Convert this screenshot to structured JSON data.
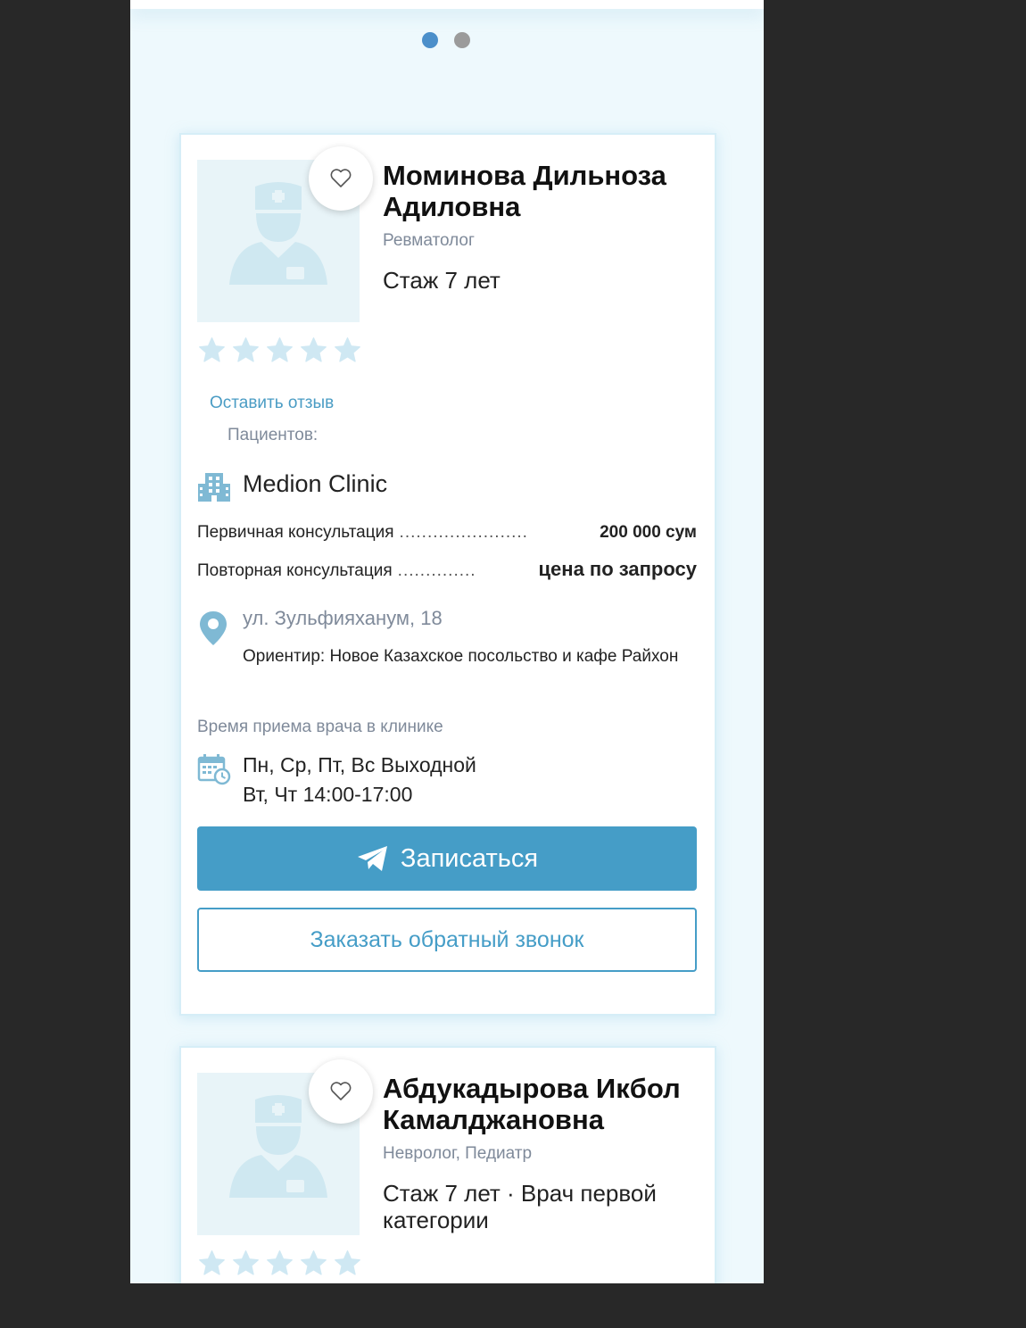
{
  "carousel": {
    "dots": 2,
    "active": 0
  },
  "doctors": [
    {
      "name": "Моминова Дильноза Адиловна",
      "specialty": "Ревматолог",
      "experience": "Стаж 7 лет",
      "rating": 0,
      "review_link": "Оставить отзыв",
      "patients_label": "Пациентов:",
      "clinic": "Medion Clinic",
      "prices": [
        {
          "label": "Первичная консультация",
          "leader": ".......................",
          "value": "200 000 сум"
        },
        {
          "label": "Повторная консультация",
          "leader": "..............",
          "value": "цена по запросу"
        }
      ],
      "address": "ул. Зульфияханум, 18",
      "landmark": "Ориентир: Новое Казахское посольство и кафе Райхон",
      "schedule_label": "Время приема врача в клинике",
      "schedule": [
        "Пн, Ср, Пт, Вс Выходной",
        "Вт, Чт 14:00-17:00"
      ],
      "book_button": "Записаться",
      "callback_button": "Заказать обратный звонок"
    },
    {
      "name": "Абдукадырова Икбол Камалджановна",
      "specialty": "Невролог, Педиатр",
      "experience": "Стаж 7 лет · Врач первой категории",
      "rating": 0
    }
  ],
  "colors": {
    "accent": "#459dc7",
    "link": "#4a9cc4",
    "muted": "#7f8a9a",
    "star": "#cfe8f3",
    "background": "#eef9fd"
  }
}
